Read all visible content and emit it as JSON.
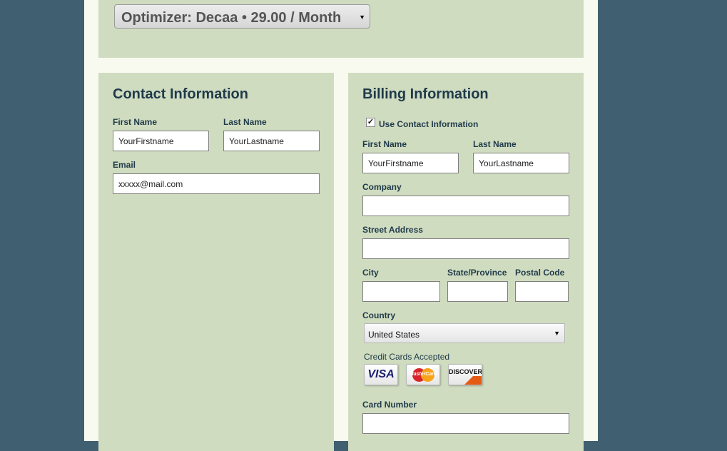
{
  "plan": {
    "selected": "Optimizer: Decaa • 29.00 / Month"
  },
  "contact": {
    "title": "Contact Information",
    "first_name_label": "First Name",
    "first_name_value": "YourFirstname",
    "last_name_label": "Last Name",
    "last_name_value": "YourLastname",
    "email_label": "Email",
    "email_value": "xxxxx@mail.com"
  },
  "billing": {
    "title": "Billing Information",
    "use_contact_label": "Use Contact Information",
    "use_contact_checked": true,
    "first_name_label": "First Name",
    "first_name_value": "YourFirstname",
    "last_name_label": "Last Name",
    "last_name_value": "YourLastname",
    "company_label": "Company",
    "company_value": "",
    "street_label": "Street Address",
    "street_value": "",
    "city_label": "City",
    "city_value": "",
    "state_label": "State/Province",
    "state_value": "",
    "postal_label": "Postal Code",
    "postal_value": "",
    "country_label": "Country",
    "country_value": "United States",
    "cards_label": "Credit Cards Accepted",
    "cards": [
      {
        "name": "visa-card-icon",
        "text": "VISA"
      },
      {
        "name": "mastercard-card-icon",
        "text": "MasterCard"
      },
      {
        "name": "discover-card-icon",
        "text": "DISCOVER"
      }
    ],
    "card_number_label": "Card Number",
    "card_number_value": ""
  },
  "colors": {
    "background": "#405f70",
    "page": "#f8faf0",
    "panel": "#d0dcc0",
    "heading": "#1f3a4a"
  }
}
